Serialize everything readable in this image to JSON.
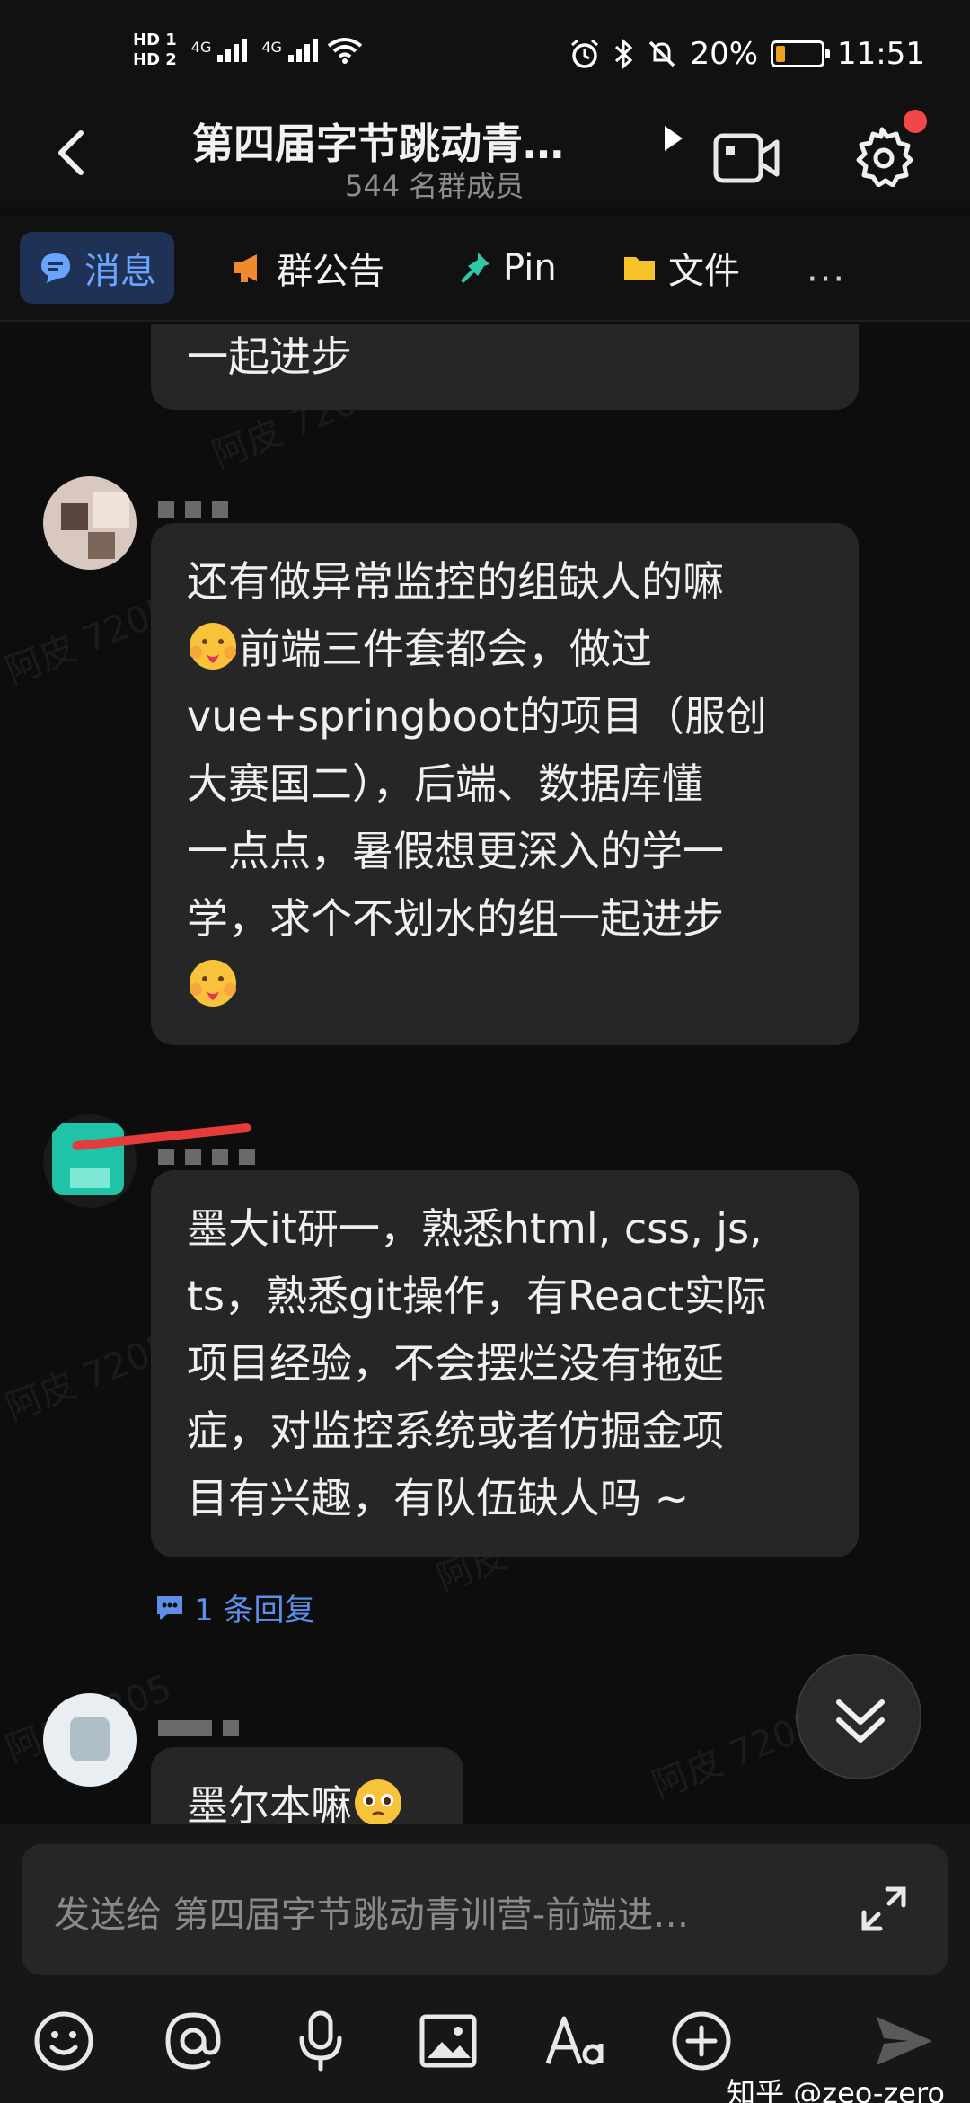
{
  "status_bar": {
    "hd1": "HD 1",
    "hd2": "HD 2",
    "net1": "4G",
    "net2": "4G",
    "battery_pct_text": "20%",
    "battery_level": 0.2,
    "time": "11:51",
    "icons": [
      "alarm-icon",
      "bluetooth-icon",
      "mute-icon"
    ]
  },
  "header": {
    "title": "第四届字节跳动青…",
    "members": "544 名群成员"
  },
  "tabs": [
    {
      "label": "消息",
      "icon": "message-icon"
    },
    {
      "label": "群公告",
      "icon": "megaphone-icon"
    },
    {
      "label": "Pin",
      "icon": "pin-icon"
    },
    {
      "label": "文件",
      "icon": "folder-icon"
    }
  ],
  "more_label": "···",
  "messages": [
    {
      "text_lines": [
        "一起进步"
      ]
    },
    {
      "text_lines": [
        "还有做异常监控的组缺人的嘛",
        "前端三件套都会，做过",
        "vue+springboot的项目（服创",
        "大赛国二），后端、数据库懂",
        "一点点，暑假想更深入的学一",
        "学，求个不划水的组一起进步"
      ]
    },
    {
      "text_lines": [
        "墨大it研一，熟悉html, css, js,",
        "ts，熟悉git操作，有React实际",
        "项目经验，不会摆烂没有拖延",
        "症，对监控系统或者仿掘金项",
        "目有兴趣，有队伍缺人吗 ~"
      ]
    },
    {
      "text_lines": [
        "墨尔本嘛"
      ]
    }
  ],
  "reply_count_label": "1 条回复",
  "watermark_text": "阿皮 7205",
  "input": {
    "placeholder": "发送给 第四届字节跳动青训营-前端进…"
  },
  "toolbar_icons": [
    "emoji-icon",
    "at-icon",
    "mic-icon",
    "image-icon",
    "text-format-icon",
    "plus-icon",
    "send-icon"
  ],
  "credit": "知乎 @zeo-zero",
  "colors": {
    "accent": "#69a4ff",
    "bubble": "#262626",
    "background": "#0d0d0d"
  }
}
